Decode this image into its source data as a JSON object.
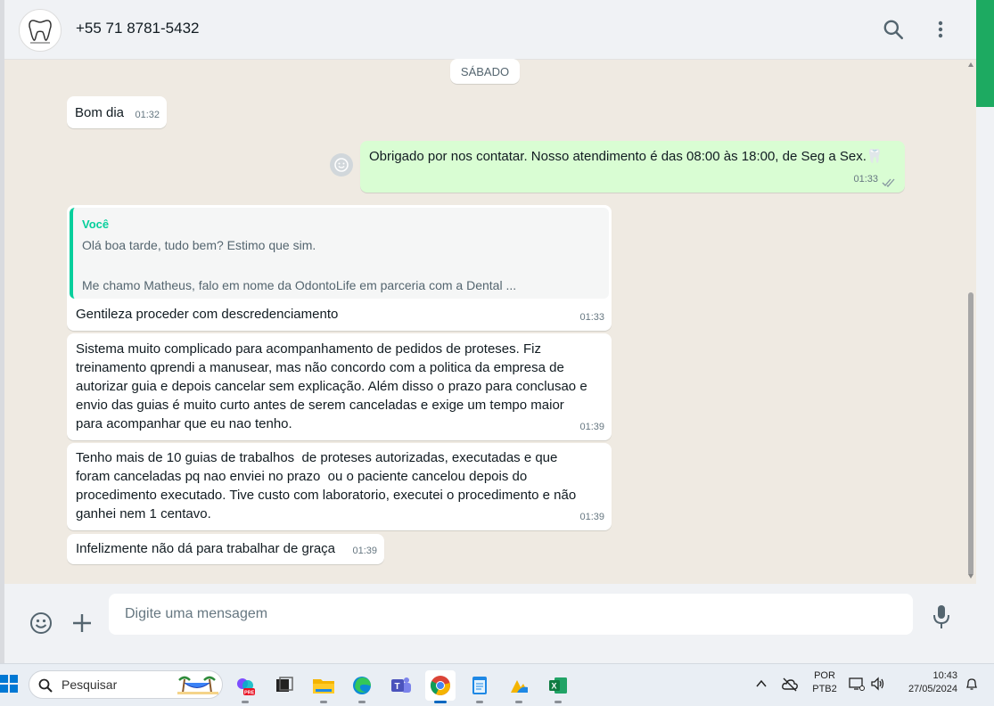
{
  "header": {
    "contact_name": "+55 71 8781-5432",
    "avatar_icon": "tooth-logo-icon",
    "search_icon": "search-icon",
    "menu_icon": "more-vertical-icon"
  },
  "date_separator": "SÁBADO",
  "messages": [
    {
      "direction": "in",
      "text": "Bom dia",
      "time": "01:32"
    },
    {
      "direction": "out",
      "text": "Obrigado por nos contatar. Nosso atendimento é das 08:00 às 18:00, de Seg a Sex.🦷",
      "time": "01:33",
      "status": "read"
    },
    {
      "direction": "in",
      "quote": {
        "author": "Você",
        "line1": "Olá boa tarde, tudo bem? Estimo que sim.",
        "line2": "Me chamo Matheus, falo em nome da OdontoLife em parceria com a Dental ..."
      },
      "text": "Gentileza proceder com descredenciamento",
      "time": "01:33"
    },
    {
      "direction": "in",
      "text": "Sistema muito complicado para acompanhamento de pedidos de proteses. Fiz\ntreinamento qprendi a manusear, mas não concordo com a politica da empresa de\nautorizar guia e depois cancelar sem explicação. Além disso o prazo para conclusao e\nenvio das guias é muito curto antes de serem canceladas e exige um tempo maior\npara acompanhar que eu nao tenho.",
      "time": "01:39"
    },
    {
      "direction": "in",
      "text": "Tenho mais de 10 guias de trabalhos  de proteses autorizadas, executadas e que\nforam canceladas pq nao enviei no prazo  ou o paciente cancelou depois do\nprocedimento executado. Tive custo com laboratorio, executei o procedimento e não\nganhei nem 1 centavo.",
      "time": "01:39"
    },
    {
      "direction": "in",
      "text": "Infelizmente não dá para trabalhar de graça",
      "time": "01:39"
    }
  ],
  "composer": {
    "placeholder": "Digite uma mensagem",
    "emoji_icon": "emoji-icon",
    "attach_icon": "plus-icon",
    "mic_icon": "microphone-icon"
  },
  "taskbar": {
    "search_label": "Pesquisar",
    "language": "POR",
    "layout": "PTB2",
    "time": "10:43",
    "date": "27/05/2024",
    "apps": [
      "copilot-icon",
      "task-view-icon",
      "file-explorer-icon",
      "edge-icon",
      "teams-icon",
      "chrome-icon",
      "notepad-icon",
      "photos-icon",
      "excel-icon"
    ]
  },
  "colors": {
    "outgoing_bubble": "#d9fdd3",
    "quote_accent": "#06cf9c",
    "chat_background": "#efeae2",
    "brand_green": "#1daa61"
  }
}
